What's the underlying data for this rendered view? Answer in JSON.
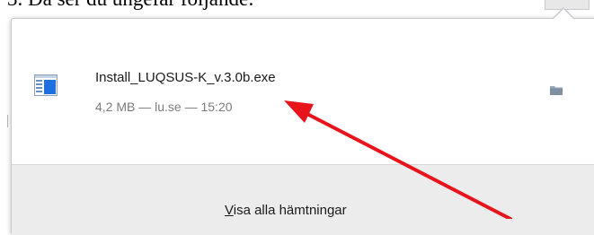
{
  "document": {
    "instruction_text": "3. Då ser du ungefär följande:"
  },
  "download_panel": {
    "item": {
      "file_name": "Install_LUQSUS-K_v.3.0b.exe",
      "meta": "4,2 MB — lu.se — 15:20",
      "file_icon": "application-window-icon",
      "action_icon": "folder-icon"
    },
    "footer": {
      "show_all_accesskey": "V",
      "show_all_rest": "isa alla hämtningar"
    }
  },
  "annotation": {
    "arrow_color": "#e8141c"
  }
}
